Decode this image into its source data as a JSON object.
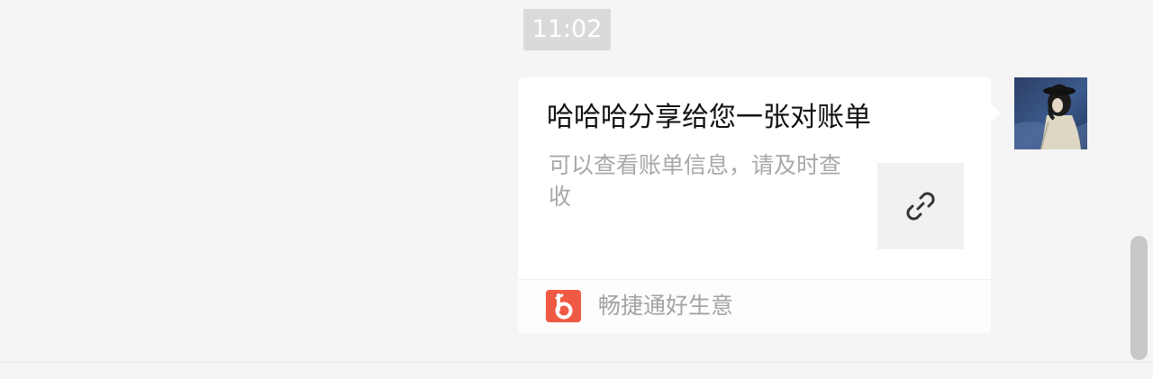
{
  "chat": {
    "timestamp": "11:02",
    "message": {
      "title": "哈哈哈分享给您一张对账单",
      "description": "可以查看账单信息，请及时查收",
      "thumbnail_icon": "link-icon",
      "source": {
        "app_name": "畅捷通好生意",
        "logo_icon": "app-logo-icon",
        "logo_color": "#ef5a45"
      }
    },
    "sender": {
      "avatar_icon": "avatar-photo"
    }
  },
  "colors": {
    "background": "#f5f5f5",
    "card": "#ffffff",
    "timestamp_bg": "#dadada"
  }
}
